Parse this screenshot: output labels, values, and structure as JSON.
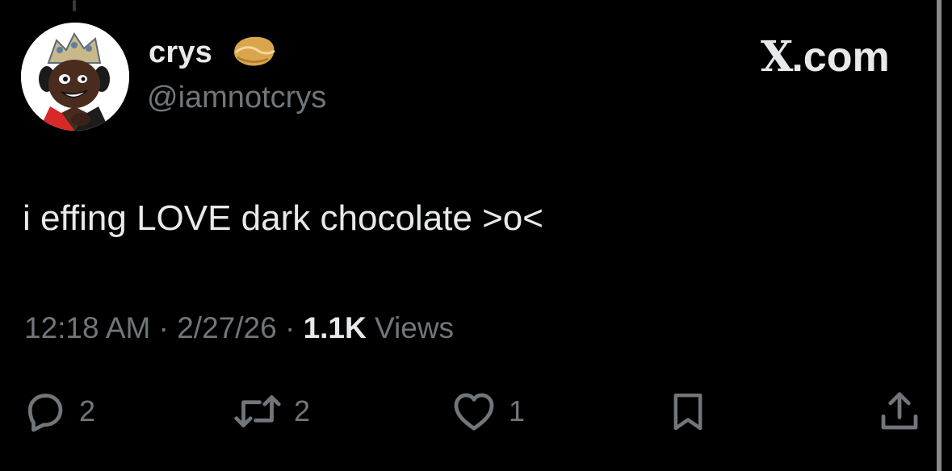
{
  "tweet": {
    "display_name": "crys",
    "handle": "@iamnotcrys",
    "text": "i effing LOVE dark chocolate >o<",
    "time": "12:18 AM",
    "date": "2/27/26",
    "views_count": "1.1K",
    "views_label": "Views",
    "separator": "·"
  },
  "brand": {
    "x_letter": "X",
    "suffix": ".com"
  },
  "actions": {
    "reply_count": "2",
    "retweet_count": "2",
    "like_count": "1"
  },
  "icons": {
    "name_badge": "fortune-cookie-icon",
    "reply": "reply-icon",
    "retweet": "retweet-icon",
    "like": "heart-icon",
    "bookmark": "bookmark-icon",
    "share": "share-icon"
  },
  "colors": {
    "background": "#000000",
    "primary_text": "#e7e9ea",
    "secondary_text": "#71767b"
  }
}
